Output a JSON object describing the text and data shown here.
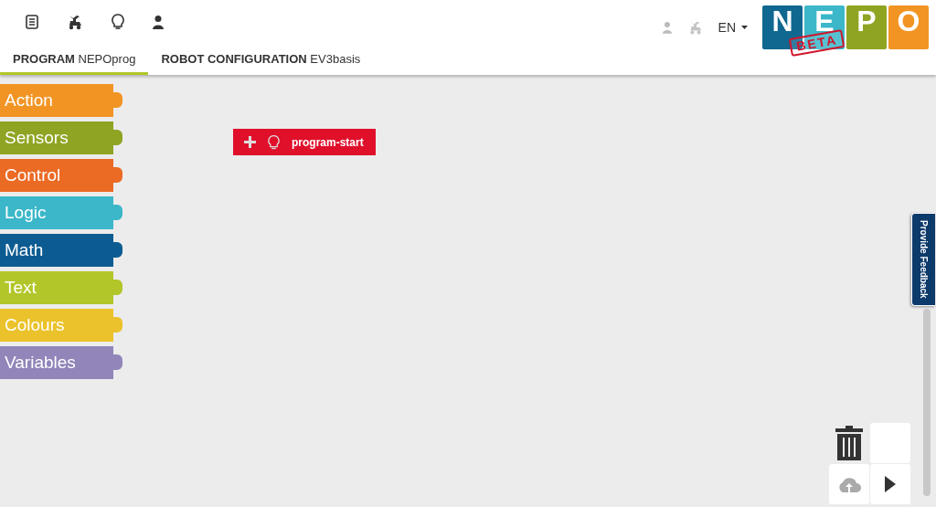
{
  "language": "EN",
  "logo": {
    "letters": [
      {
        "letter": "N",
        "color": "#10678f"
      },
      {
        "letter": "E",
        "color": "#3bb7c9"
      },
      {
        "letter": "P",
        "color": "#8fa422"
      },
      {
        "letter": "O",
        "color": "#f29424"
      }
    ],
    "stamp": "BETA"
  },
  "tabs": [
    {
      "label": "PROGRAM",
      "name": "NEPOprog",
      "selected": true
    },
    {
      "label": "ROBOT CONFIGURATION",
      "name": "EV3basis",
      "selected": false
    }
  ],
  "categories": [
    {
      "label": "Action",
      "color": "#f29424"
    },
    {
      "label": "Sensors",
      "color": "#8fa422"
    },
    {
      "label": "Control",
      "color": "#eb6a24"
    },
    {
      "label": "Logic",
      "color": "#3bb7c9"
    },
    {
      "label": "Math",
      "color": "#0c5b91"
    },
    {
      "label": "Text",
      "color": "#b2c629"
    },
    {
      "label": "Colours",
      "color": "#ebc22b"
    },
    {
      "label": "Variables",
      "color": "#9185b9"
    }
  ],
  "start_block": {
    "label": "program-start"
  },
  "feedback": "Provide Feedback"
}
